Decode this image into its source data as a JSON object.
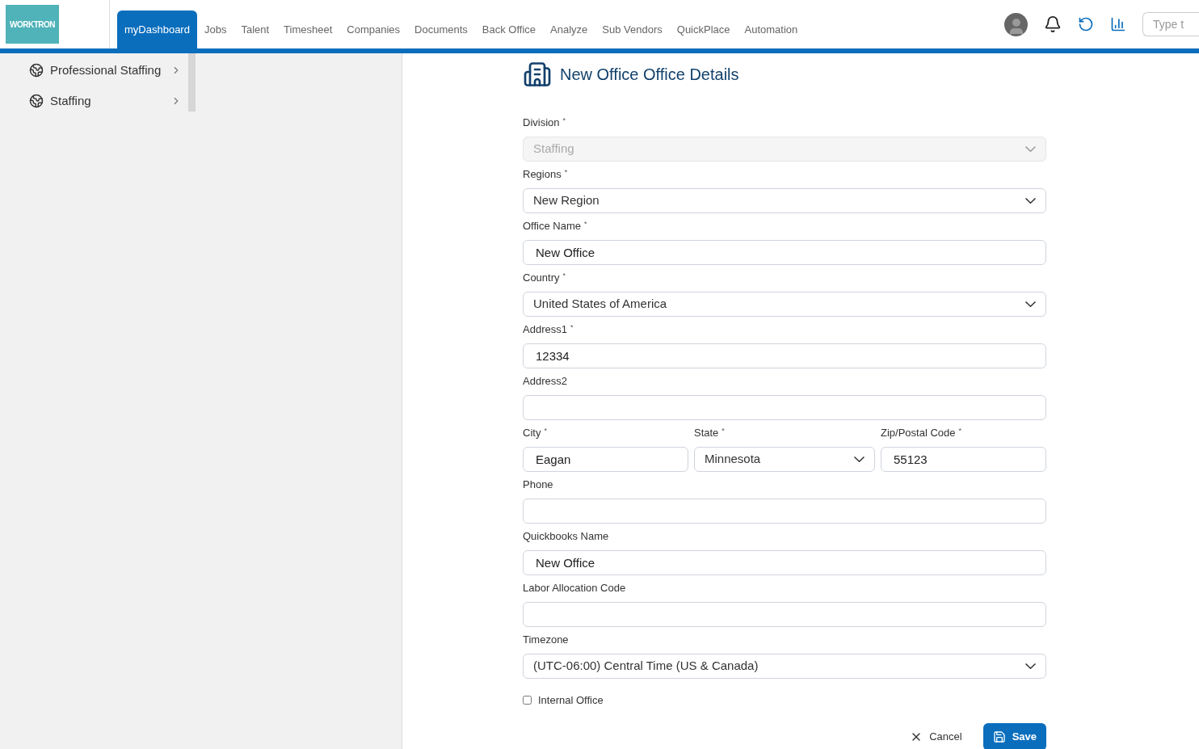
{
  "logo": {
    "text": "WORKTRON"
  },
  "nav": [
    {
      "label": "myDashboard",
      "selected": true
    },
    {
      "label": "Jobs",
      "selected": false
    },
    {
      "label": "Talent",
      "selected": false
    },
    {
      "label": "Timesheet",
      "selected": false
    },
    {
      "label": "Companies",
      "selected": false
    },
    {
      "label": "Documents",
      "selected": false
    },
    {
      "label": "Back Office",
      "selected": false
    },
    {
      "label": "Analyze",
      "selected": false
    },
    {
      "label": "Sub Vendors",
      "selected": false
    },
    {
      "label": "QuickPlace",
      "selected": false
    },
    {
      "label": "Automation",
      "selected": false
    }
  ],
  "search": {
    "placeholder": "Type t"
  },
  "sidebar": {
    "items": [
      {
        "label": "Professional Staffing"
      },
      {
        "label": "Staffing"
      }
    ]
  },
  "form": {
    "title": "New Office Office Details",
    "rows": [
      [
        {
          "label": "Division",
          "required_mark": "*",
          "kind": "select",
          "value": "Staffing",
          "disabled": true
        }
      ],
      [
        {
          "label": "Regions",
          "required_mark": "*",
          "kind": "select",
          "value": "New Region",
          "disabled": false
        }
      ],
      [
        {
          "label": "Office Name",
          "required_mark": "*",
          "kind": "input",
          "value": "New Office",
          "disabled": false
        }
      ],
      [
        {
          "label": "Country",
          "required_mark": "*",
          "kind": "select",
          "value": "United States of America",
          "disabled": false
        }
      ],
      [
        {
          "label": "Address1",
          "required_mark": "*",
          "kind": "input",
          "value": "12334",
          "disabled": false
        }
      ],
      [
        {
          "label": "Address2",
          "kind": "input",
          "disabled": false
        }
      ],
      [
        {
          "label": "City",
          "required_mark": "*",
          "kind": "input",
          "value": "Eagan",
          "disabled": false
        },
        {
          "label": "State",
          "required_mark": "*",
          "kind": "select",
          "value": "Minnesota",
          "disabled": false
        },
        {
          "label": "Zip/Postal Code",
          "required_mark": "*",
          "kind": "input",
          "value": "55123",
          "disabled": false
        }
      ],
      [
        {
          "label": "Phone",
          "kind": "input",
          "disabled": false
        }
      ],
      [
        {
          "label": "Quickbooks Name",
          "kind": "input",
          "value": "New Office",
          "disabled": false
        }
      ],
      [
        {
          "label": "Labor Allocation Code",
          "kind": "input",
          "disabled": false
        }
      ],
      [
        {
          "label": "Timezone",
          "kind": "select",
          "value": "(UTC-06:00) Central Time (US & Canada)",
          "disabled": false
        }
      ]
    ],
    "checkbox": {
      "label": "Internal Office",
      "checked": false
    },
    "buttons": {
      "cancel": "Cancel",
      "save": "Save"
    }
  }
}
